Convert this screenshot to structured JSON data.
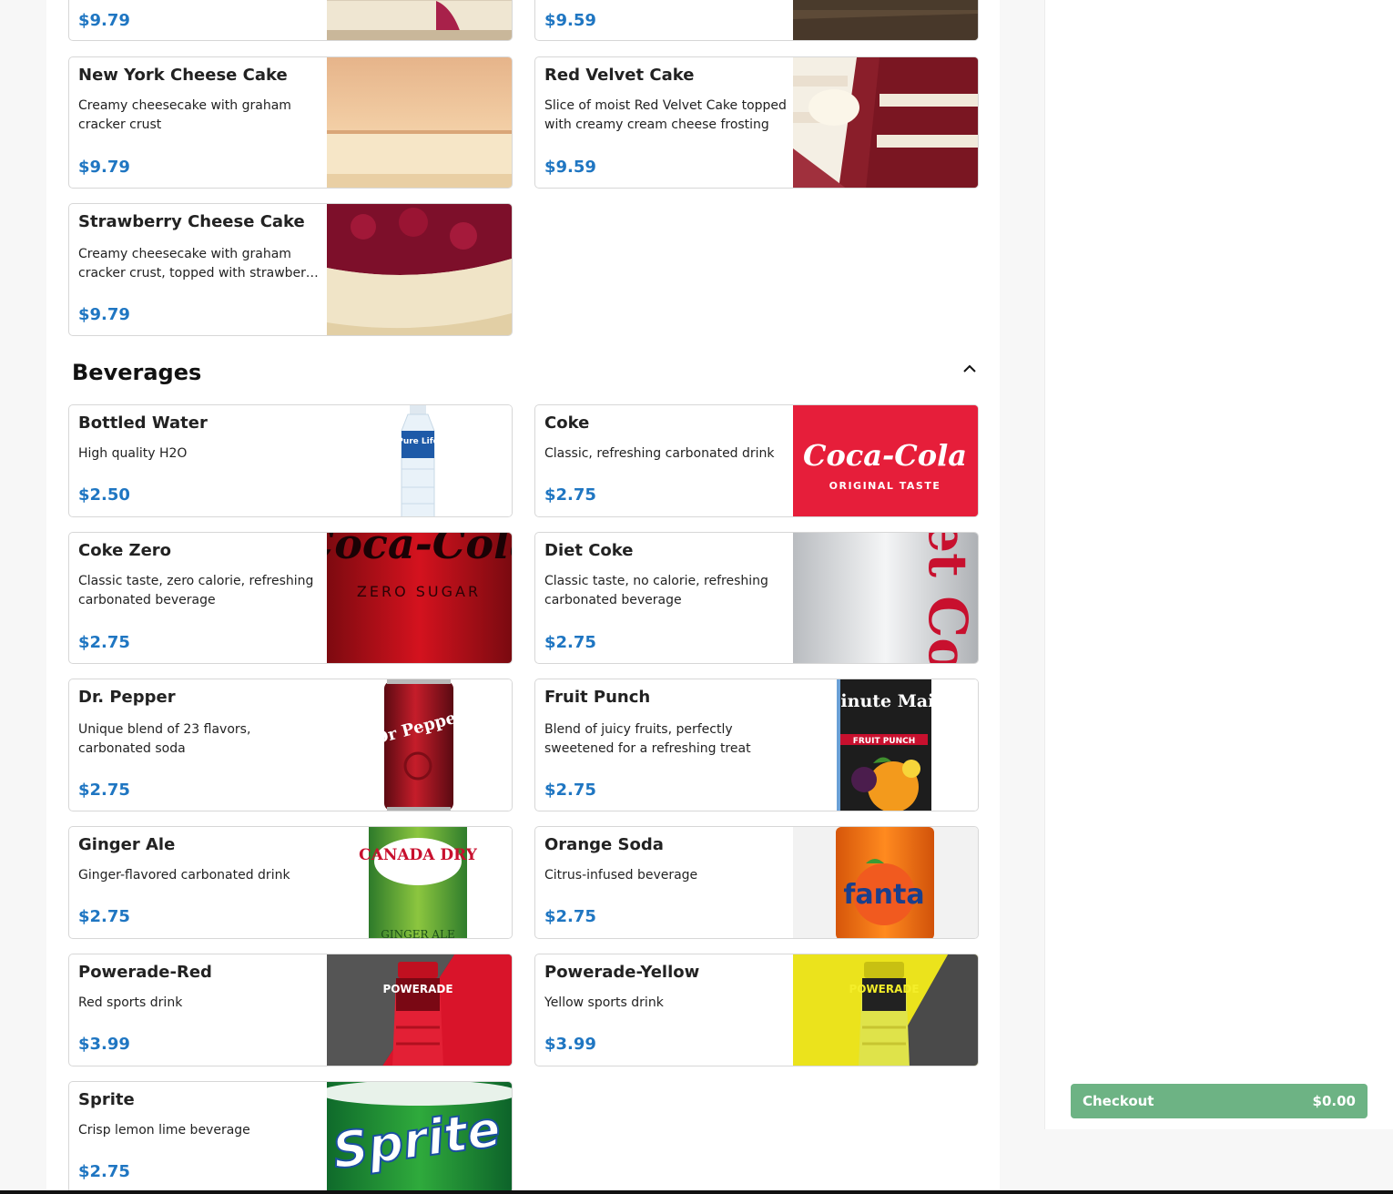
{
  "menu": {
    "cakes_partial": [
      {
        "price": "$9.79"
      },
      {
        "price": "$9.59"
      }
    ],
    "cakes": [
      {
        "name": "New York Cheese Cake",
        "description": "Creamy cheesecake with graham cracker crust",
        "price": "$9.79"
      },
      {
        "name": "Red Velvet Cake",
        "description": "Slice of moist Red Velvet Cake topped with creamy cream cheese frosting",
        "price": "$9.59"
      },
      {
        "name": "Strawberry Cheese Cake",
        "description": "Creamy cheesecake with graham cracker crust, topped with strawberry topping",
        "price": "$9.79"
      }
    ],
    "beverages_section": {
      "title": "Beverages"
    },
    "beverages": [
      {
        "name": "Bottled Water",
        "description": "High quality H2O",
        "price": "$2.50"
      },
      {
        "name": "Coke",
        "description": "Classic, refreshing carbonated drink",
        "price": "$2.75"
      },
      {
        "name": "Coke Zero",
        "description": "Classic taste, zero calorie, refreshing carbonated beverage",
        "price": "$2.75"
      },
      {
        "name": "Diet Coke",
        "description": "Classic taste, no calorie, refreshing carbonated beverage",
        "price": "$2.75"
      },
      {
        "name": "Dr. Pepper",
        "description": "Unique blend of 23 flavors, carbonated soda",
        "price": "$2.75"
      },
      {
        "name": "Fruit Punch",
        "description": "Blend of juicy fruits, perfectly sweetened for a refreshing treat",
        "price": "$2.75"
      },
      {
        "name": "Ginger Ale",
        "description": "Ginger-flavored carbonated drink",
        "price": "$2.75"
      },
      {
        "name": "Orange Soda",
        "description": "Citrus-infused beverage",
        "price": "$2.75"
      },
      {
        "name": "Powerade-Red",
        "description": "Red sports drink",
        "price": "$3.99"
      },
      {
        "name": "Powerade-Yellow",
        "description": "Yellow sports drink",
        "price": "$3.99"
      },
      {
        "name": "Sprite",
        "description": "Crisp lemon lime beverage",
        "price": "$2.75"
      }
    ]
  },
  "product_logos": {
    "coke": {
      "script": "Coca-Cola",
      "tagline": "ORIGINAL TASTE"
    },
    "coke_zero": {
      "script": "Coca-Cola",
      "tagline": "ZERO SUGAR"
    },
    "diet_coke": {
      "script": "Diet Coke"
    },
    "water": {
      "brand": "Pure Life"
    },
    "dr_pepper": {
      "brand": "Dr Pepper"
    },
    "fruit_punch": {
      "brand": "Minute Maid",
      "flavor": "FRUIT PUNCH"
    },
    "ginger_ale": {
      "brand": "CANADA DRY",
      "flavor": "GINGER ALE"
    },
    "orange": {
      "brand": "fanta"
    },
    "powerade": {
      "brand": "POWERADE"
    },
    "sprite": {
      "brand": "Sprite"
    }
  },
  "cart": {
    "checkout_label": "Checkout",
    "total": "$0.00"
  },
  "colors": {
    "price": "#1f76c2",
    "checkout": "#6db384",
    "coke_red": "#e61e3a"
  },
  "icons": {
    "collapse": "chevron-up-icon"
  }
}
